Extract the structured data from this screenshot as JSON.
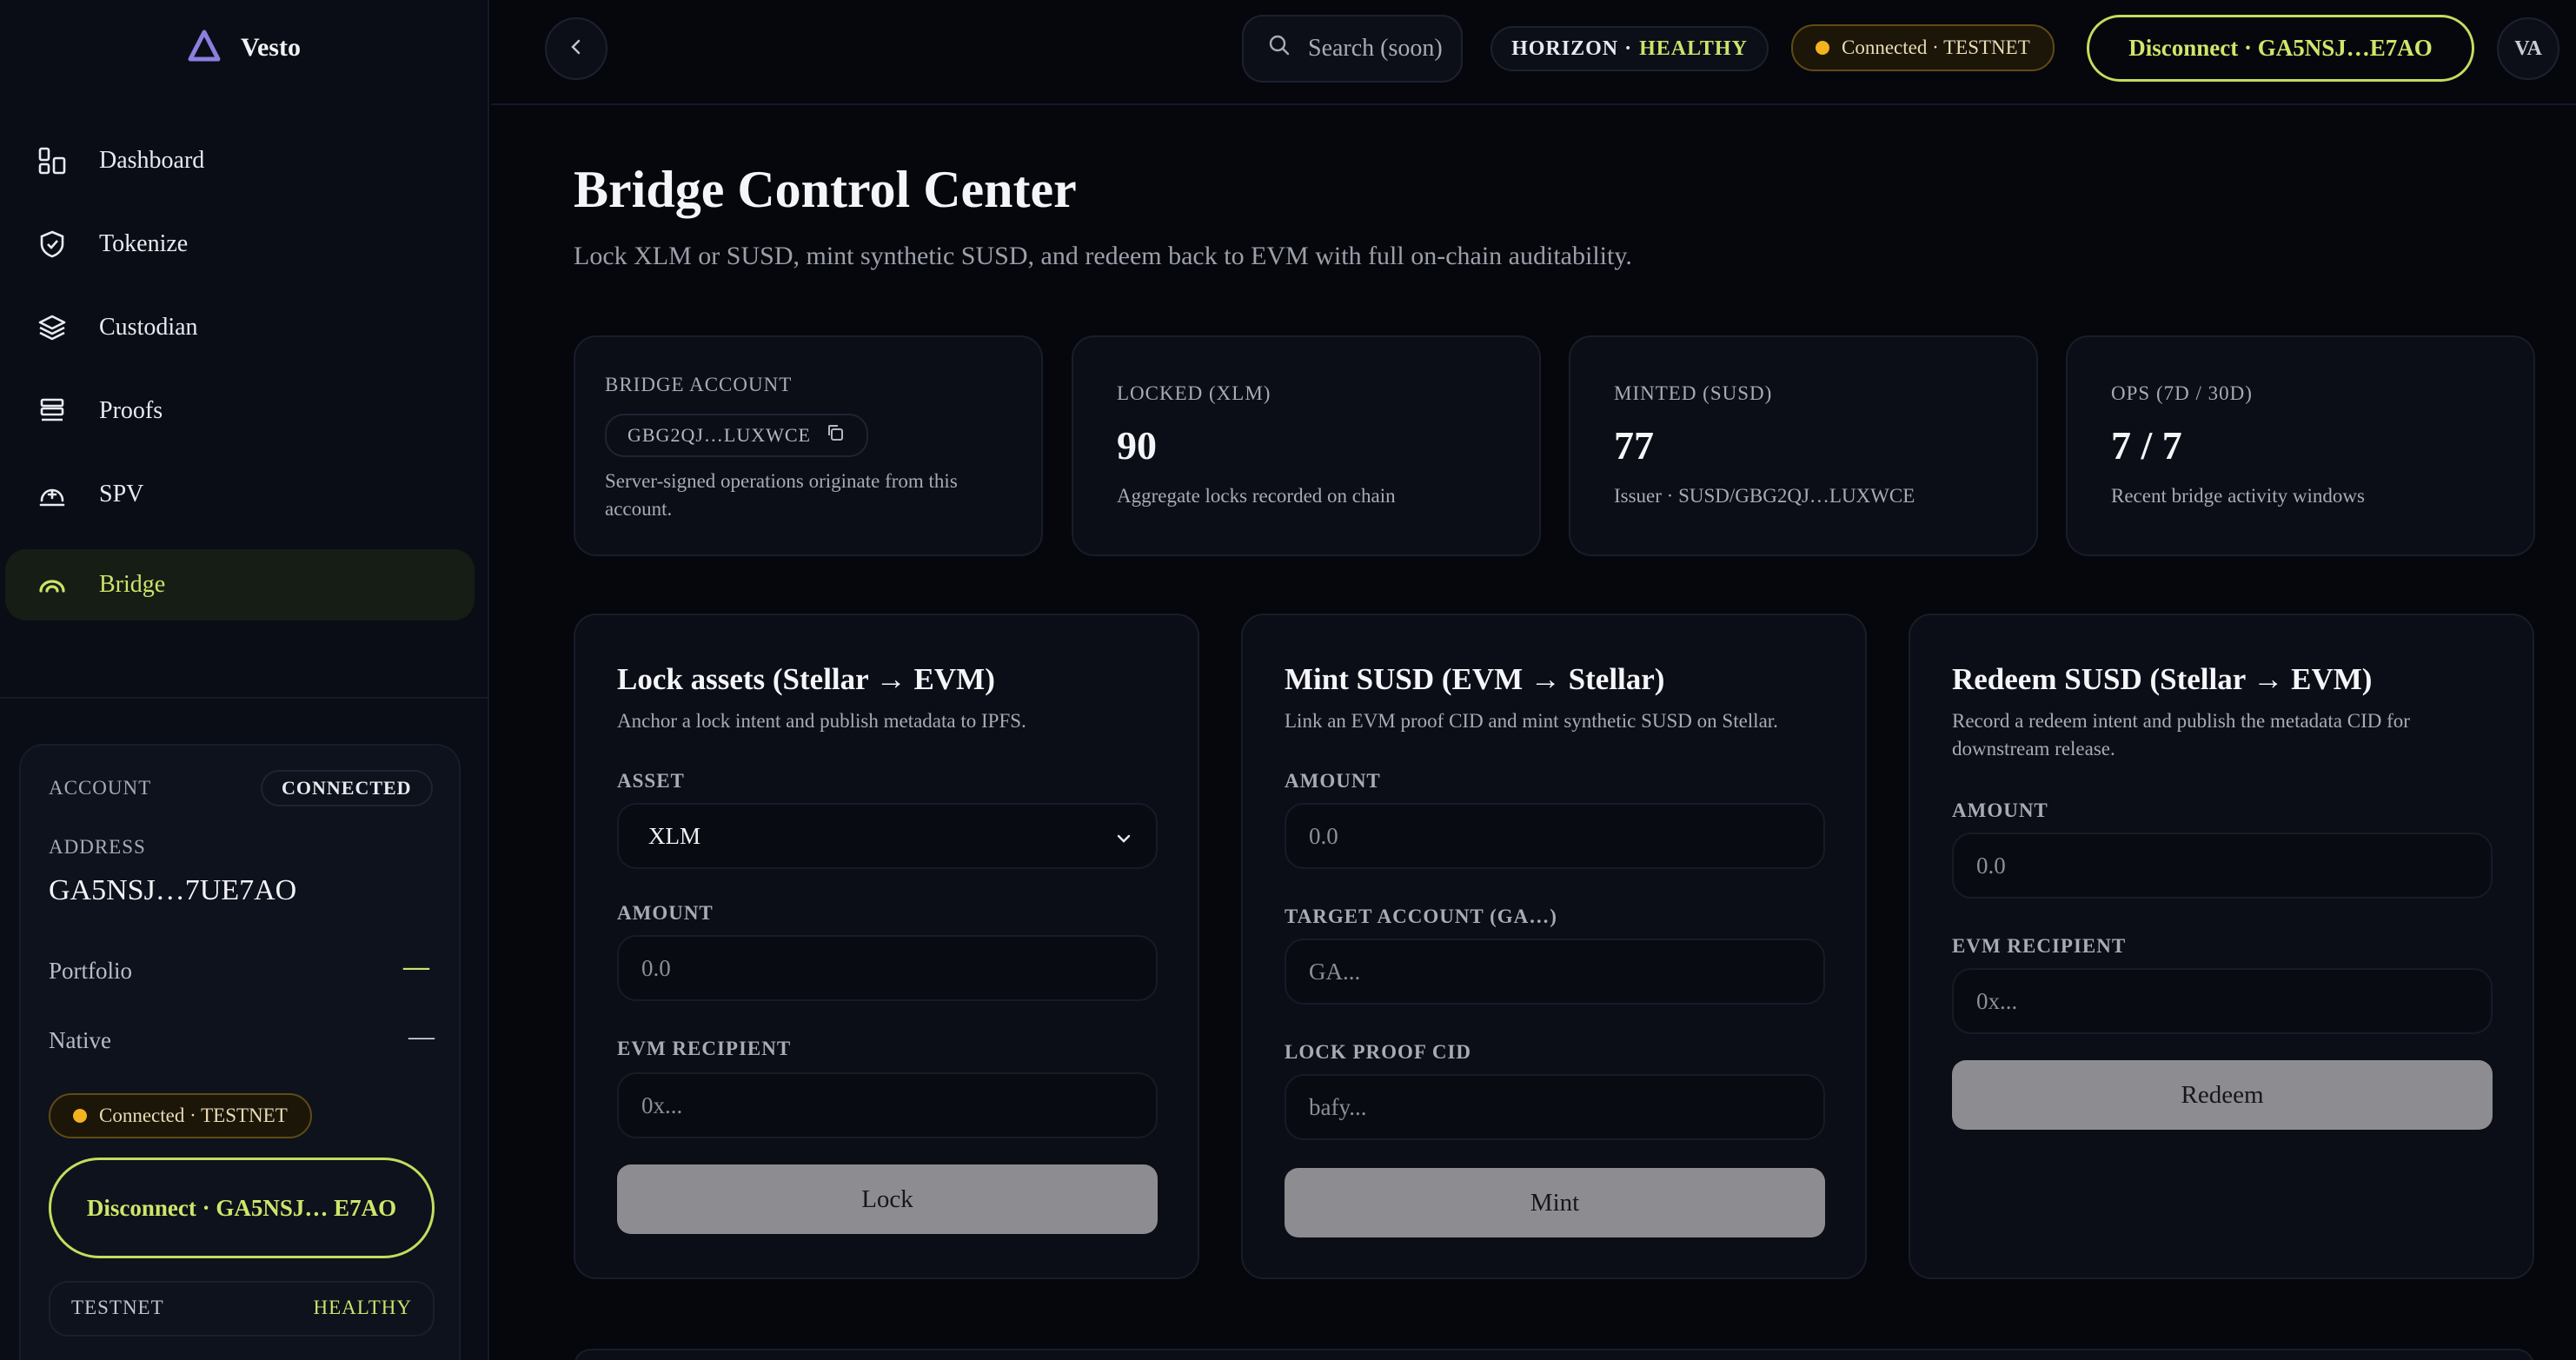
{
  "brand": {
    "name": "Vesto",
    "logo_icon": "triangle-logo-icon"
  },
  "sidebar": {
    "items": [
      {
        "label": "Dashboard",
        "icon": "dashboard-icon"
      },
      {
        "label": "Tokenize",
        "icon": "shield-icon"
      },
      {
        "label": "Custodian",
        "icon": "layers-icon"
      },
      {
        "label": "Proofs",
        "icon": "list-icon"
      },
      {
        "label": "SPV",
        "icon": "gauge-plus-icon"
      },
      {
        "label": "Bridge",
        "icon": "bridge-arc-icon",
        "active": true
      }
    ],
    "account": {
      "label": "ACCOUNT",
      "status": "CONNECTED",
      "address_label": "ADDRESS",
      "address": "GA5NSJ…7UE7AO",
      "portfolio_label": "Portfolio",
      "portfolio_value": "—",
      "native_label": "Native",
      "native_value": "—",
      "network_status": "Connected · TESTNET",
      "disconnect_label": "Disconnect · GA5NSJ… E7AO",
      "network_name": "TESTNET",
      "network_health": "HEALTHY"
    }
  },
  "topbar": {
    "collapse_icon": "chevron-left-icon",
    "search_placeholder": "Search (soon)",
    "horizon_label": "HORIZON ·",
    "horizon_status": "HEALTHY",
    "connection_status": "Connected · TESTNET",
    "disconnect_label": "Disconnect · GA5NSJ…E7AO",
    "avatar_initials": "VA"
  },
  "page": {
    "title": "Bridge Control Center",
    "subtitle": "Lock XLM or SUSD, mint synthetic SUSD, and redeem back to EVM with full on-chain auditability."
  },
  "stats": {
    "bridge_account": {
      "label": "BRIDGE ACCOUNT",
      "address": "GBG2QJ…LUXWCE",
      "note": "Server-signed operations originate from this account."
    },
    "locked": {
      "label": "LOCKED (XLM)",
      "value": "90",
      "note": "Aggregate locks recorded on chain"
    },
    "minted": {
      "label": "MINTED (SUSD)",
      "value": "77",
      "note": "Issuer · SUSD/GBG2QJ…LUXWCE"
    },
    "ops": {
      "label": "OPS (7D / 30D)",
      "value": "7 / 7",
      "note": "Recent bridge activity windows"
    }
  },
  "panels": {
    "lock": {
      "title": "Lock assets (Stellar → EVM)",
      "description": "Anchor a lock intent and publish metadata to IPFS.",
      "asset_label": "ASSET",
      "asset_value": "XLM",
      "amount_label": "AMOUNT",
      "amount_placeholder": "0.0",
      "recipient_label": "EVM RECIPIENT",
      "recipient_placeholder": "0x...",
      "button": "Lock"
    },
    "mint": {
      "title": "Mint SUSD (EVM → Stellar)",
      "description": "Link an EVM proof CID and mint synthetic SUSD on Stellar.",
      "amount_label": "AMOUNT",
      "amount_placeholder": "0.0",
      "target_label": "TARGET ACCOUNT (GA…)",
      "target_placeholder": "GA...",
      "proof_label": "LOCK PROOF CID",
      "proof_placeholder": "bafy...",
      "button": "Mint"
    },
    "redeem": {
      "title": "Redeem SUSD (Stellar → EVM)",
      "description": "Record a redeem intent and publish the metadata CID for downstream release.",
      "amount_label": "AMOUNT",
      "amount_placeholder": "0.0",
      "recipient_label": "EVM RECIPIENT",
      "recipient_placeholder": "0x...",
      "button": "Redeem"
    }
  },
  "colors": {
    "accent": "#cde36b",
    "background": "#05070d",
    "warning_dot": "#f2b31f"
  }
}
